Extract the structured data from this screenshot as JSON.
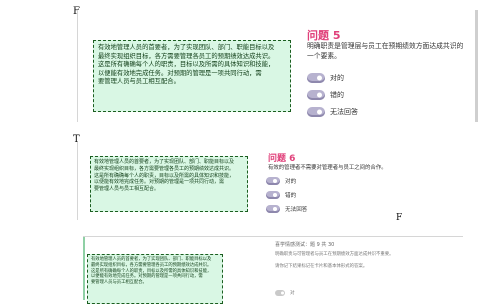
{
  "markers": {
    "top": "F",
    "middle": "T",
    "middle_right": "F"
  },
  "panel1": {
    "note_lines": [
      "有效地管理人员的首要者，为了实现团队、部门、职能目标以及",
      "最终实现组织目标，各方需要管理各员工的预期绩效达成共识。",
      "这是所有确确每个人的职责，目标以及所需的具体知识和技能，",
      "以便能有效地完成任务。对预期的管理是一项共同行动，需",
      "要管理人员与员工相互配合。"
    ],
    "question": "问题 5",
    "prompt": "明确职责是管理层与员工在预期绩效方面达成共识的一个要素。",
    "options": [
      "对的",
      "错的",
      "无法回答"
    ]
  },
  "panel2": {
    "note_lines": [
      "有效地管理人员的首要者，为了实现团队、部门、职能目标以及",
      "最终实现组织目标，各方需要管理各员工的预期绩效达成共识。",
      "这是所有确确每个人的职责，目标以及所需的具体知识和技能，",
      "以便能有效地完成任务。对预期的管理是一项共同行动，需",
      "要管理人员与员工相互配合。"
    ],
    "question": "问题 6",
    "prompt": "有效的管理者不需要对管理者与员工之间的合作。",
    "options": [
      "对的",
      "错的",
      "无法回答"
    ]
  },
  "panel3": {
    "header": "喜学情感测试：题 9 共 30",
    "prompt_a": "明确职责与可管理者与员工在预期绩效方面达成共识不重要。",
    "prompt_b": "请你记下结果标记在卡片和基本体形式的答案。",
    "note_lines": [
      "有效地管理人员的首要者，为了实现团队、部门、职能目标以及",
      "最终实现组织目标，各方需要管理各员工的预期绩效达成共识。",
      "这是所有确确每个人的职责，目标以及所需的具体知识和技能，",
      "以便能有效地完成任务。对预期的管理是一项共同行动，需",
      "要管理人员与员工相互配合。"
    ],
    "option": "对"
  }
}
